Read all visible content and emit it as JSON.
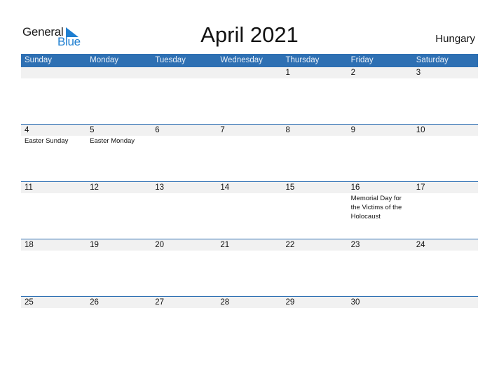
{
  "logo": {
    "word1": "General",
    "word2": "Blue"
  },
  "title": "April 2021",
  "country": "Hungary",
  "colors": {
    "header_bg": "#2e70b3",
    "daynum_bg": "#f1f1f1",
    "logo_blue": "#1f7fd1"
  },
  "weekdays": [
    "Sunday",
    "Monday",
    "Tuesday",
    "Wednesday",
    "Thursday",
    "Friday",
    "Saturday"
  ],
  "weeks": [
    {
      "days": [
        "",
        "",
        "",
        "",
        "1",
        "2",
        "3"
      ],
      "events": [
        "",
        "",
        "",
        "",
        "",
        "",
        ""
      ]
    },
    {
      "days": [
        "4",
        "5",
        "6",
        "7",
        "8",
        "9",
        "10"
      ],
      "events": [
        "Easter Sunday",
        "Easter Monday",
        "",
        "",
        "",
        "",
        ""
      ]
    },
    {
      "days": [
        "11",
        "12",
        "13",
        "14",
        "15",
        "16",
        "17"
      ],
      "events": [
        "",
        "",
        "",
        "",
        "",
        "Memorial Day for the Victims of the Holocaust",
        ""
      ]
    },
    {
      "days": [
        "18",
        "19",
        "20",
        "21",
        "22",
        "23",
        "24"
      ],
      "events": [
        "",
        "",
        "",
        "",
        "",
        "",
        ""
      ]
    },
    {
      "days": [
        "25",
        "26",
        "27",
        "28",
        "29",
        "30",
        ""
      ],
      "events": [
        "",
        "",
        "",
        "",
        "",
        "",
        ""
      ]
    }
  ]
}
